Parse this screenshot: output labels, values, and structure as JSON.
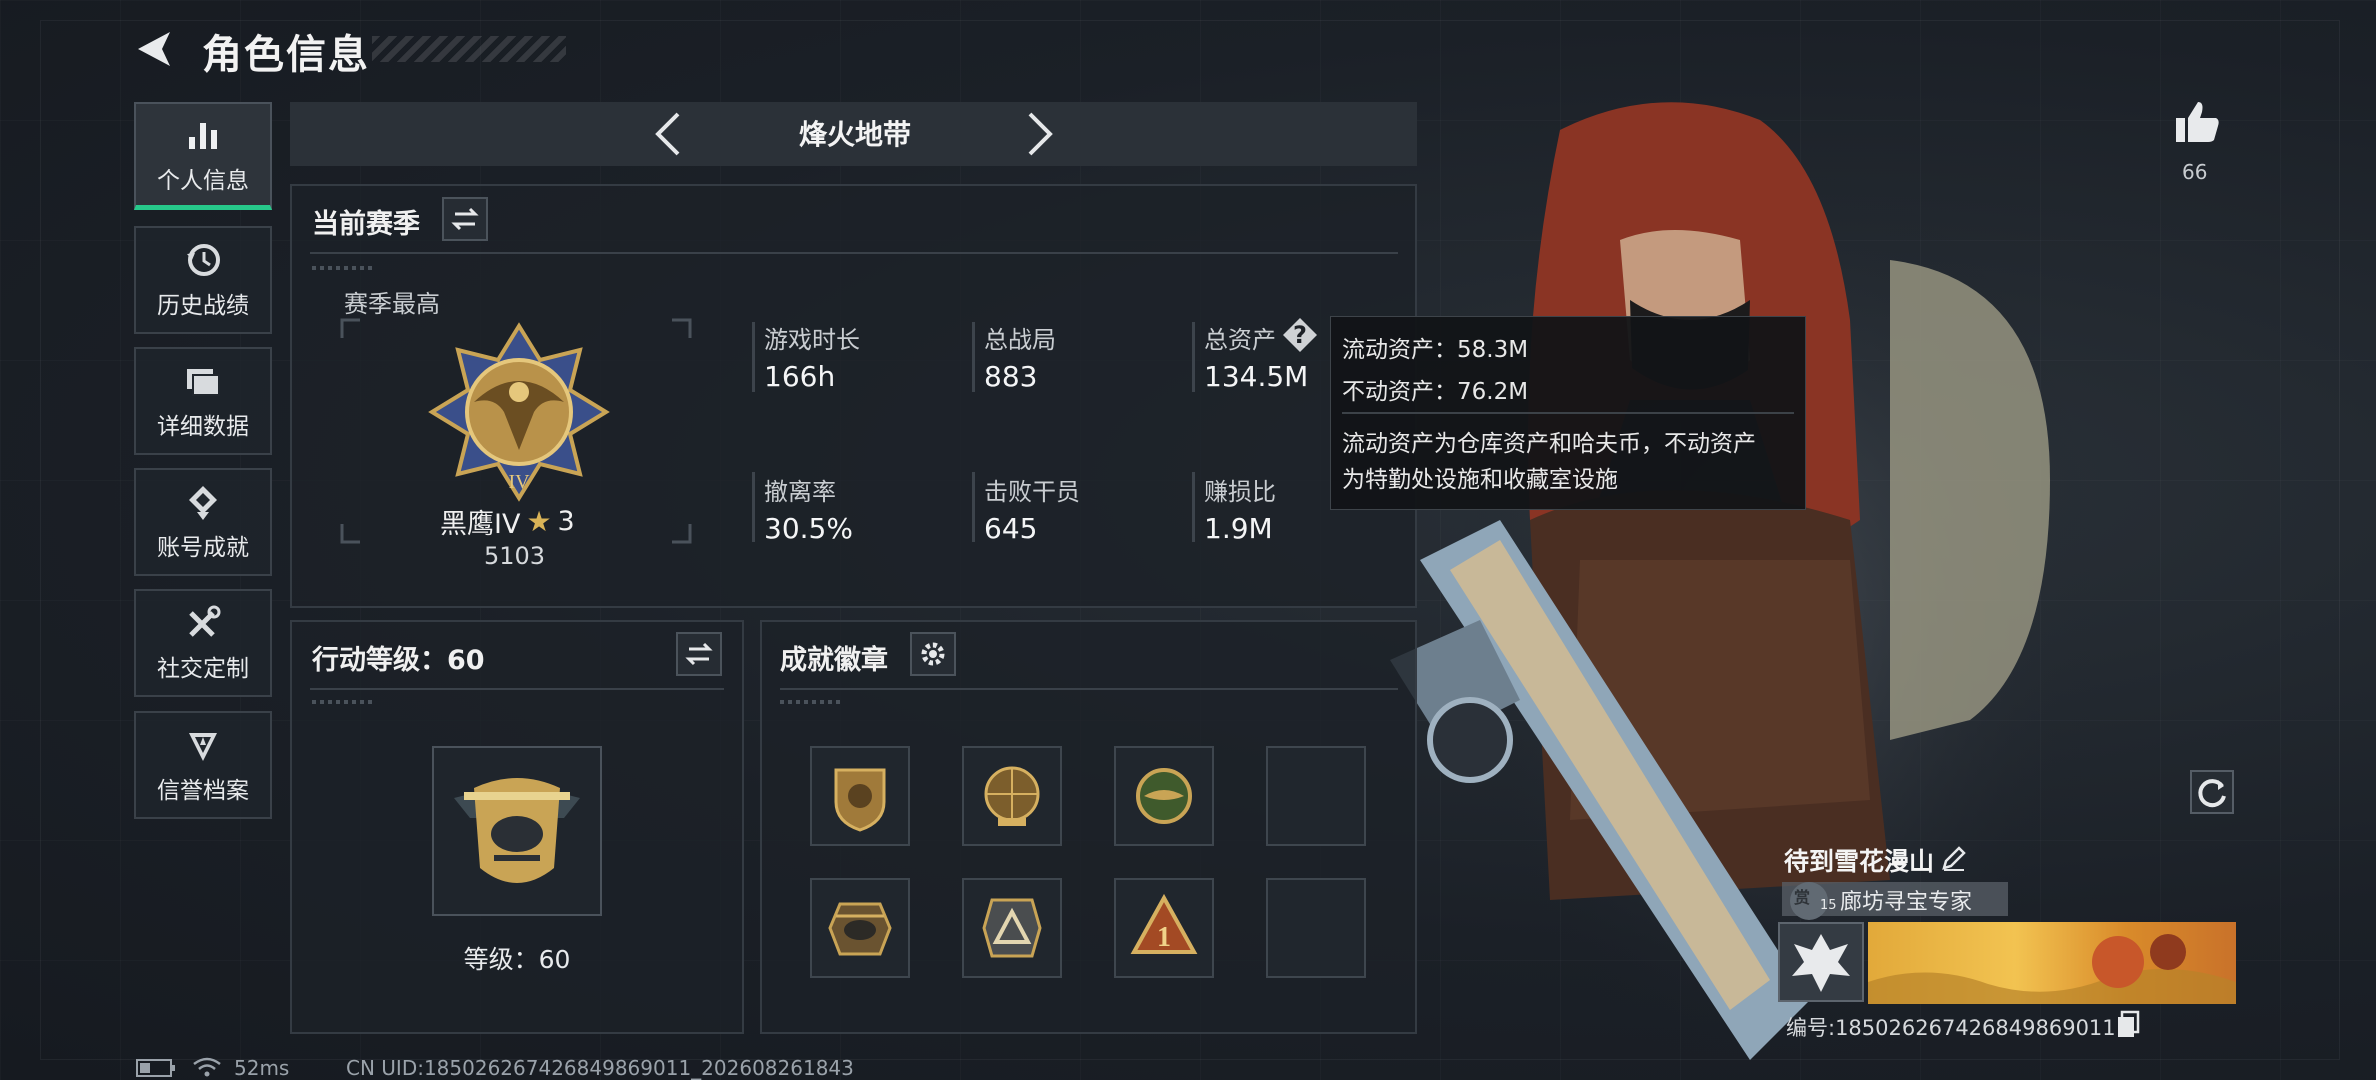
{
  "header": {
    "title": "角色信息"
  },
  "sidebar": {
    "items": [
      {
        "label": "个人信息",
        "active": true
      },
      {
        "label": "历史战绩"
      },
      {
        "label": "详细数据"
      },
      {
        "label": "账号成就"
      },
      {
        "label": "社交定制"
      },
      {
        "label": "信誉档案"
      }
    ]
  },
  "mode": {
    "title": "烽火地带"
  },
  "season": {
    "title": "当前赛季",
    "best_label": "赛季最高",
    "rank_name": "黑鹰IV",
    "rank_star": "3",
    "rank_score": "5103",
    "stats": [
      {
        "label": "游戏时长",
        "value": "166h"
      },
      {
        "label": "总战局",
        "value": "883"
      },
      {
        "label": "总资产",
        "value": "134.5M"
      },
      {
        "label": "撤离率",
        "value": "30.5%"
      },
      {
        "label": "击败干员",
        "value": "645"
      },
      {
        "label": "赚损比",
        "value": "1.9M"
      }
    ]
  },
  "tooltip": {
    "liquid": "流动资产：58.3M",
    "fixed": "不动资产：76.2M",
    "desc_1": "流动资产为仓库资产和哈夫币，不动资产",
    "desc_2": "为特勤处设施和收藏室设施"
  },
  "action_level": {
    "title": "行动等级：60",
    "level_text": "等级：60"
  },
  "achievements": {
    "title": "成就徽章"
  },
  "profile": {
    "like_count": "66",
    "player_name": "待到雪花漫山",
    "title_tag": "廊坊寻宝专家",
    "level_small": "15",
    "account_id": "编号:185026267426849869011"
  },
  "status_bar": {
    "ping": "52ms",
    "uid": "CN UID:185026267426849869011_202608261843"
  },
  "colors": {
    "accent": "#27c98b",
    "gold": "#c9a455",
    "panel_border": "#343b43"
  }
}
